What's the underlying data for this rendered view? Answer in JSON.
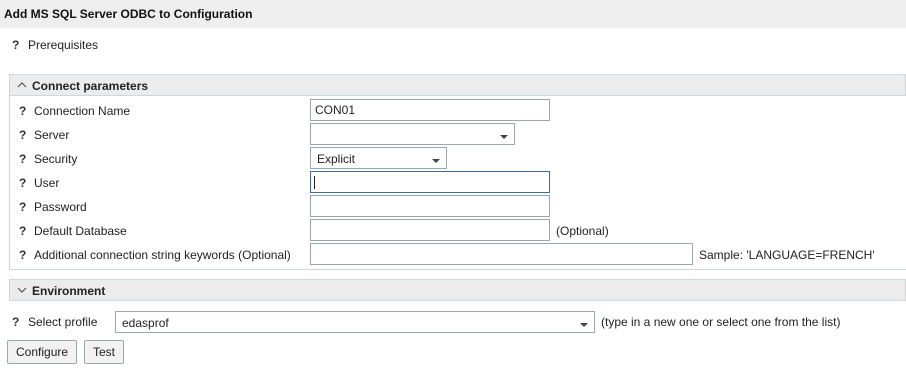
{
  "window": {
    "title": "Add MS SQL Server ODBC to Configuration"
  },
  "prerequisites": {
    "help": "?",
    "label": "Prerequisites"
  },
  "connect_section": {
    "title": "Connect parameters",
    "expanded": true,
    "fields": {
      "connection_name": {
        "help": "?",
        "label": "Connection Name",
        "value": "CON01"
      },
      "server": {
        "help": "?",
        "label": "Server",
        "value": ""
      },
      "security": {
        "help": "?",
        "label": "Security",
        "value": "Explicit"
      },
      "user": {
        "help": "?",
        "label": "User",
        "value": ""
      },
      "password": {
        "help": "?",
        "label": "Password",
        "value": ""
      },
      "default_database": {
        "help": "?",
        "label": "Default Database",
        "value": "",
        "note": "(Optional)"
      },
      "additional_keywords": {
        "help": "?",
        "label": "Additional connection string keywords (Optional)",
        "value": "",
        "note": "Sample: 'LANGUAGE=FRENCH'"
      }
    }
  },
  "environment_section": {
    "title": "Environment",
    "expanded": false
  },
  "profile": {
    "help": "?",
    "label": "Select profile",
    "value": "edasprof",
    "hint": "(type in a new one or select one from the list)"
  },
  "buttons": {
    "configure": "Configure",
    "test": "Test"
  }
}
